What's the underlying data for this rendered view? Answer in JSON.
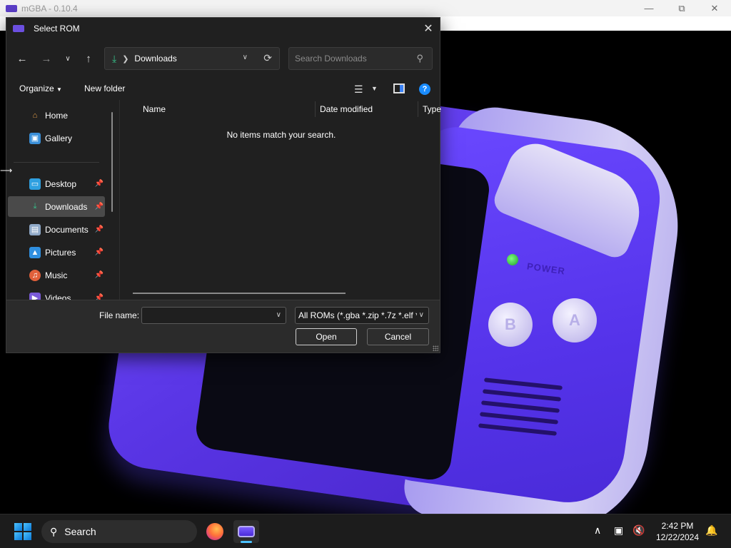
{
  "app": {
    "title": "mGBA - 0.10.4",
    "window_buttons": [
      "minimize",
      "maximize",
      "close"
    ]
  },
  "game": {
    "power_label": "POWER",
    "button_b": "B",
    "button_a": "A",
    "body_color": "#5a36e6"
  },
  "dialog": {
    "title": "Select ROM",
    "nav": {
      "back_icon": "arrow-left-icon",
      "forward_icon": "arrow-right-icon",
      "recent_icon": "chevron-down-icon",
      "up_icon": "arrow-up-icon"
    },
    "address": {
      "location": "Downloads",
      "accent": "#37c08a"
    },
    "search": {
      "placeholder": "Search Downloads",
      "value": ""
    },
    "commands": {
      "organize": "Organize",
      "new_folder": "New folder"
    },
    "sidebar": {
      "items": [
        {
          "label": "Home",
          "icon": "home-icon",
          "pinned": false
        },
        {
          "label": "Gallery",
          "icon": "gallery-icon",
          "pinned": false
        },
        {
          "label": "Desktop",
          "icon": "desktop-icon",
          "pinned": true
        },
        {
          "label": "Downloads",
          "icon": "downloads-icon",
          "pinned": true,
          "selected": true
        },
        {
          "label": "Documents",
          "icon": "documents-icon",
          "pinned": true
        },
        {
          "label": "Pictures",
          "icon": "pictures-icon",
          "pinned": true
        },
        {
          "label": "Music",
          "icon": "music-icon",
          "pinned": true
        },
        {
          "label": "Videos",
          "icon": "videos-icon",
          "pinned": true
        }
      ]
    },
    "columns": [
      "Name",
      "Date modified",
      "Type"
    ],
    "empty_message": "No items match your search.",
    "file_name": {
      "label": "File name:",
      "value": ""
    },
    "filter": {
      "selected": "All ROMs (*.gba *.zip *.7z *.elf *"
    },
    "buttons": {
      "open": "Open",
      "cancel": "Cancel"
    }
  },
  "taskbar": {
    "search_label": "Search",
    "apps": [
      "firefox-icon",
      "mgba-icon"
    ],
    "clock": {
      "time": "2:42 PM",
      "date": "12/22/2024"
    },
    "accent": "#4cc2ff"
  }
}
